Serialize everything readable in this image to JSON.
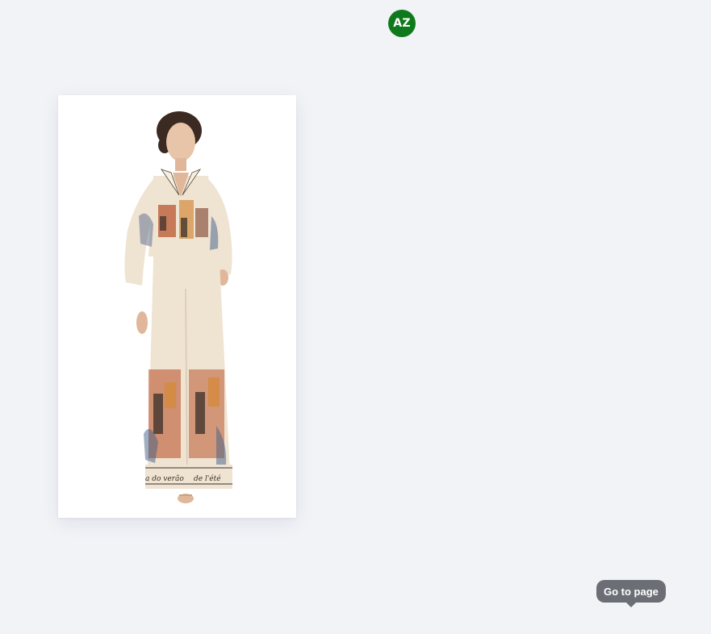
{
  "user": {
    "avatar_initials": "AZ",
    "avatar_color": "#0f7a1c"
  },
  "page": {
    "thumbnail_name": "fashion-model-printed-pajama-set",
    "pant_text_left": "a do verão",
    "pant_text_right": "de l'été"
  },
  "tooltip": {
    "label": "Go to page"
  },
  "colors": {
    "background": "#f1f3f7",
    "card": "#ffffff",
    "tooltip_bg": "#6b6e75",
    "fabric": "#efe3d2"
  }
}
